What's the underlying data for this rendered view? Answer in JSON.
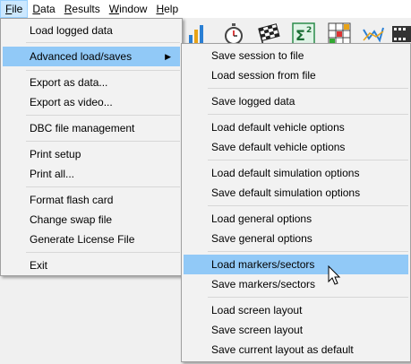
{
  "menubar": {
    "items": [
      {
        "label": "File",
        "u": "F",
        "rest": "ile"
      },
      {
        "label": "Data",
        "u": "D",
        "rest": "ata"
      },
      {
        "label": "Results",
        "u": "R",
        "rest": "esults"
      },
      {
        "label": "Window",
        "u": "W",
        "rest": "indow"
      },
      {
        "label": "Help",
        "u": "H",
        "rest": "elp"
      }
    ]
  },
  "file_menu": {
    "items": [
      "Load logged data",
      "Advanced load/saves",
      "Export as data...",
      "Export as video...",
      "DBC file management",
      "Print setup",
      "Print all...",
      "Format flash card",
      "Change swap file",
      "Generate License File",
      "Exit"
    ],
    "submenu_arrow": "▶"
  },
  "sub_menu": {
    "items": [
      "Save session to file",
      "Load session from file",
      "Save logged data",
      "Load default vehicle options",
      "Save default vehicle options",
      "Load default simulation options",
      "Save default simulation options",
      "Load general options",
      "Save general options",
      "Load markers/sectors",
      "Save markers/sectors",
      "Load screen layout",
      "Save screen layout",
      "Save current layout as default"
    ]
  },
  "toolbar": {
    "icons": [
      "bar-chart-icon",
      "stopwatch-icon",
      "checkered-flag-icon",
      "sigma-squared-icon",
      "grid-tool-icon",
      "line-graph-icon",
      "film-icon"
    ]
  },
  "colors": {
    "highlight": "#91c9f7",
    "menubar_active": "#cce8ff"
  }
}
